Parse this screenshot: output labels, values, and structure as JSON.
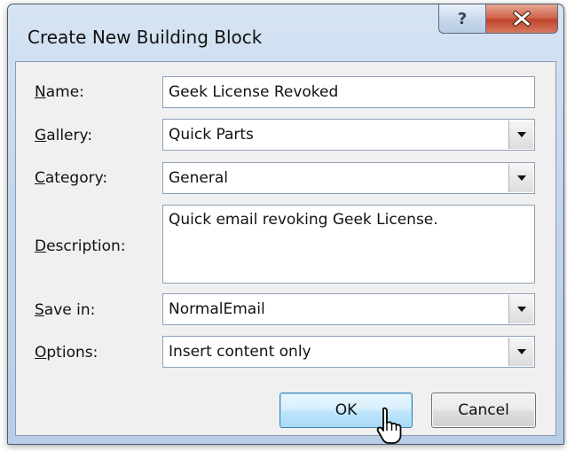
{
  "dialog": {
    "title": "Create New Building Block",
    "help_button_glyph": "?",
    "close_icon": "close-icon",
    "help_icon": "help-icon"
  },
  "fields": {
    "name": {
      "label_mnemonic": "N",
      "label_rest": "ame:",
      "value": "Geek License Revoked"
    },
    "gallery": {
      "label_mnemonic": "G",
      "label_rest": "allery:",
      "value": "Quick Parts"
    },
    "category": {
      "label_mnemonic": "C",
      "label_rest": "ategory:",
      "value": "General"
    },
    "description": {
      "label_mnemonic": "D",
      "label_rest": "escription:",
      "value": "Quick email revoking Geek License."
    },
    "save_in": {
      "label_mnemonic": "S",
      "label_rest": "ave in:",
      "value": "NormalEmail"
    },
    "options": {
      "label_mnemonic": "O",
      "label_rest": "ptions:",
      "value": "Insert content only"
    }
  },
  "buttons": {
    "ok_label": "OK",
    "cancel_label": "Cancel"
  },
  "colors": {
    "close_button_red": "#c0442c",
    "ok_button_blue": "#bee6fd",
    "window_frame": "#c3d6ec"
  }
}
